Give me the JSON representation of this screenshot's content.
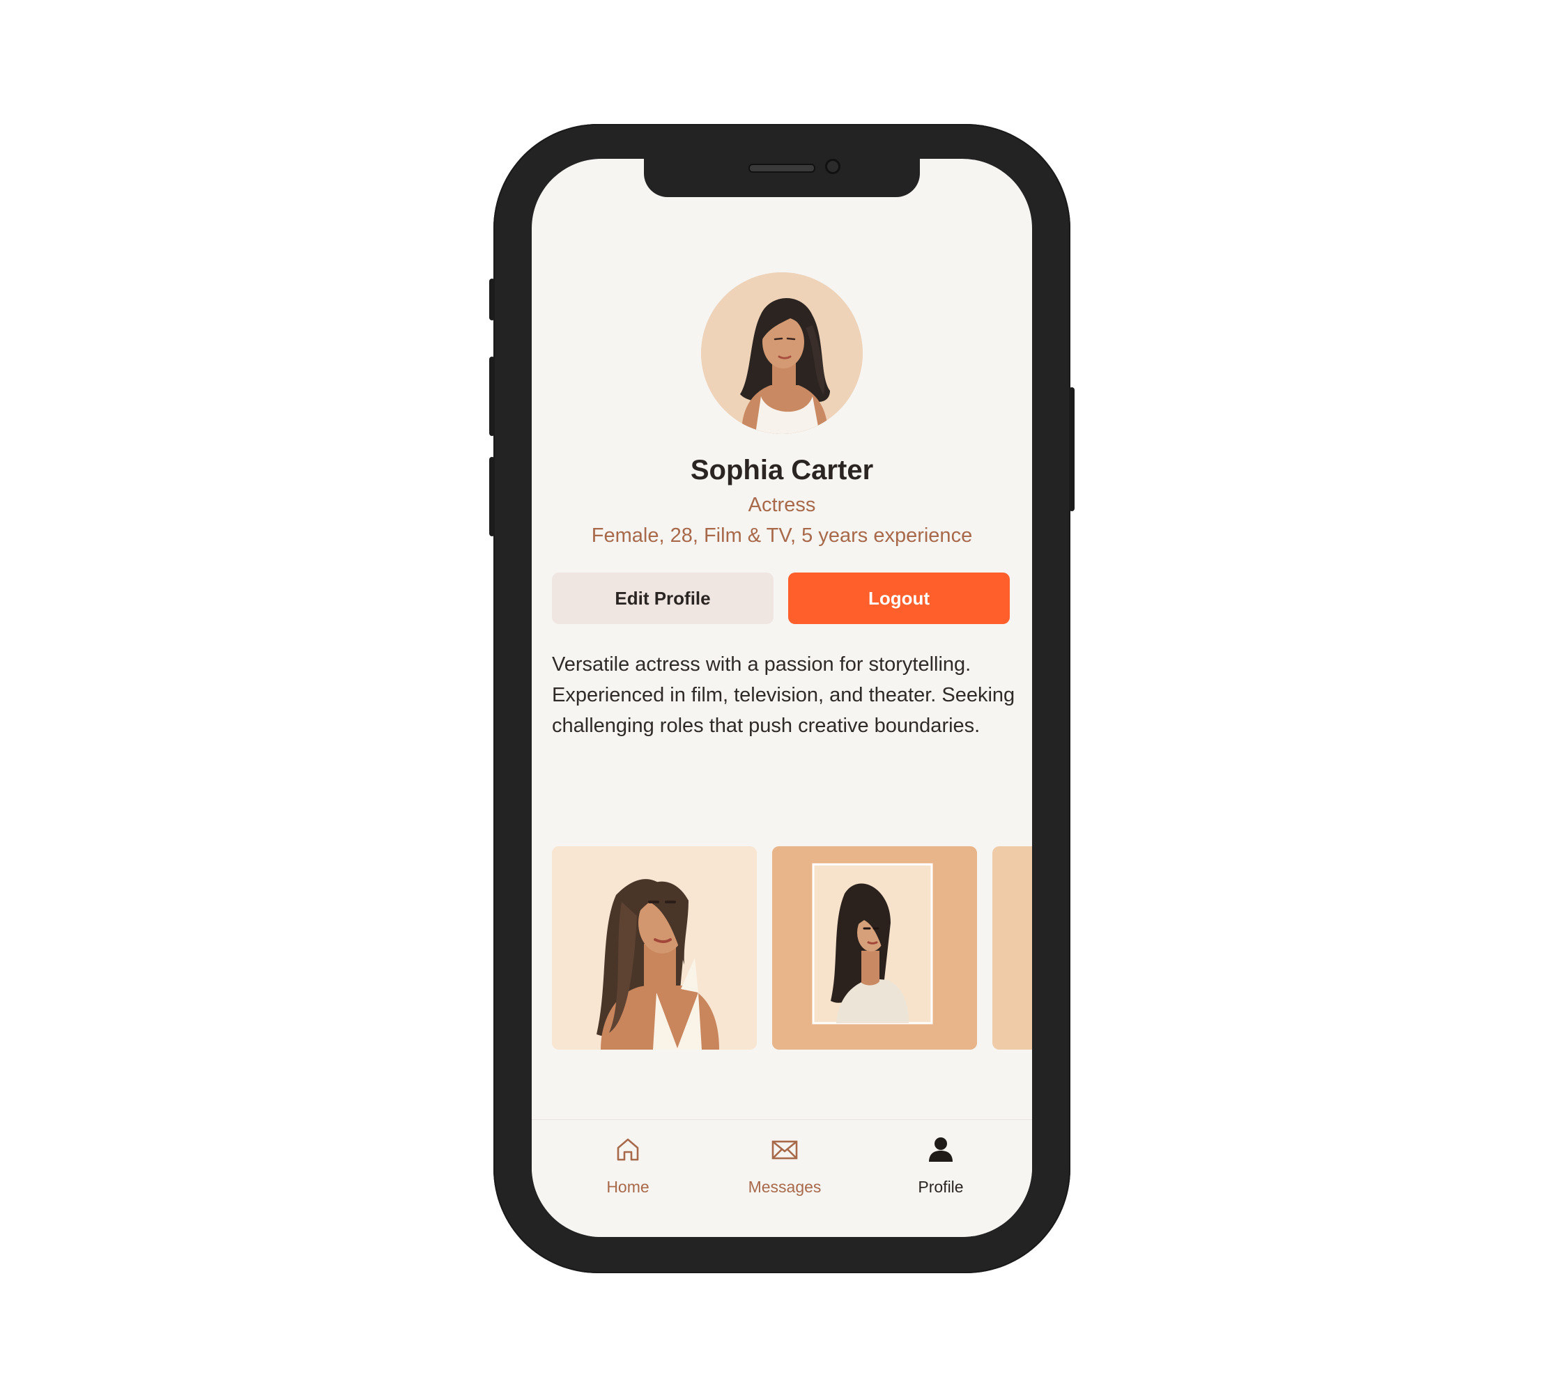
{
  "profile": {
    "name": "Sophia Carter",
    "role": "Actress",
    "details": "Female, 28, Film & TV, 5 years experience",
    "bio": "Versatile actress with a passion for storytelling. Experienced in film, television, and theater. Seeking challenging roles that push creative boundaries."
  },
  "actions": {
    "edit_label": "Edit Profile",
    "logout_label": "Logout"
  },
  "tabs": [
    {
      "label": "Home",
      "icon": "home-icon",
      "active": false
    },
    {
      "label": "Messages",
      "icon": "envelope-icon",
      "active": false
    },
    {
      "label": "Profile",
      "icon": "user-icon",
      "active": true
    }
  ],
  "colors": {
    "accent": "#ff5f2a",
    "muted_text": "#a8694a",
    "screen_bg": "#f7f5f2",
    "phone_frame": "#232323"
  }
}
